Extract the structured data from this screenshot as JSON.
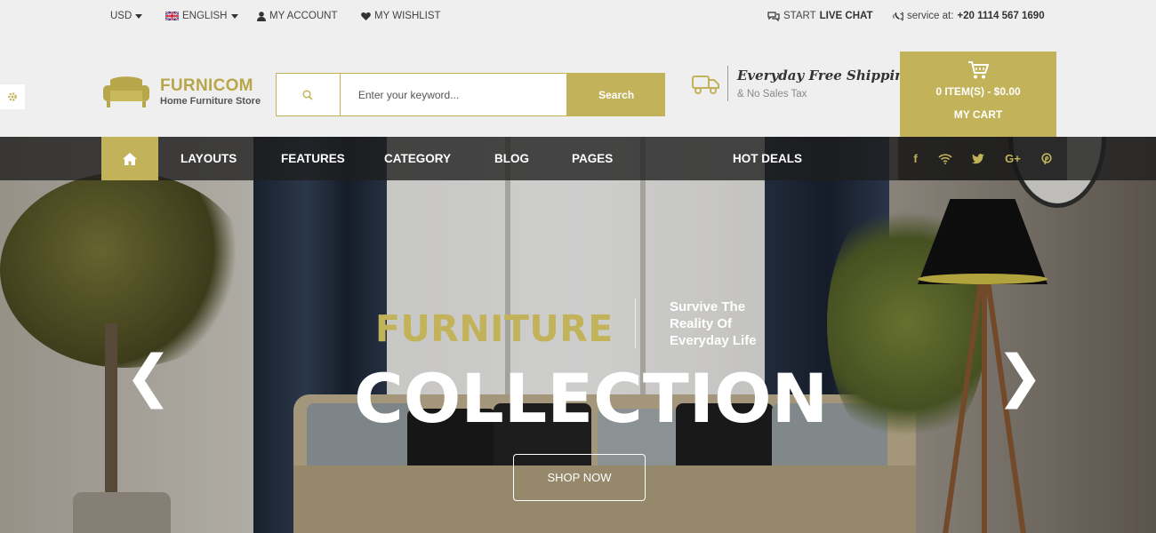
{
  "topbar": {
    "currency": "USD",
    "language": "ENGLISH",
    "account": "MY ACCOUNT",
    "wishlist": "MY WISHLIST",
    "chat_prefix": "START",
    "chat_bold": "LIVE CHAT",
    "service_prefix": "service at:",
    "service_phone": "+20 1114 567 1690"
  },
  "logo": {
    "name_a": "FURNI",
    "name_b": "COM",
    "tagline": "Home Furniture Store"
  },
  "search": {
    "placeholder": "Enter your keyword...",
    "button": "Search"
  },
  "shipping": {
    "title": "Everyday Free Shipping",
    "subtitle": "& No Sales Tax"
  },
  "cart": {
    "summary": "0 ITEM(S) - $0.00",
    "label": "MY CART"
  },
  "nav": {
    "items": [
      "LAYOUTS",
      "FEATURES",
      "CATEGORY",
      "BLOG",
      "PAGES",
      "HOT DEALS"
    ],
    "social": [
      "f",
      "G+"
    ]
  },
  "hero": {
    "kicker": "FURNITURE",
    "tagline": "Survive The Reality Of Everyday Life",
    "headline": "COLLECTION",
    "cta": "SHOP NOW",
    "prev": "❮",
    "next": "❯"
  },
  "colors": {
    "accent": "#c2b35a",
    "nav_bg": "#1e1e1e",
    "topbar_bg": "#efefef"
  },
  "icons": [
    "caret-down-icon",
    "uk-flag-icon",
    "user-icon",
    "heart-icon",
    "chat-icon",
    "phone-icon",
    "sofa-logo-icon",
    "search-icon",
    "truck-icon",
    "cart-icon",
    "gear-icon",
    "home-icon",
    "facebook-icon",
    "wifi-icon",
    "twitter-icon",
    "google-plus-icon",
    "pinterest-icon"
  ]
}
